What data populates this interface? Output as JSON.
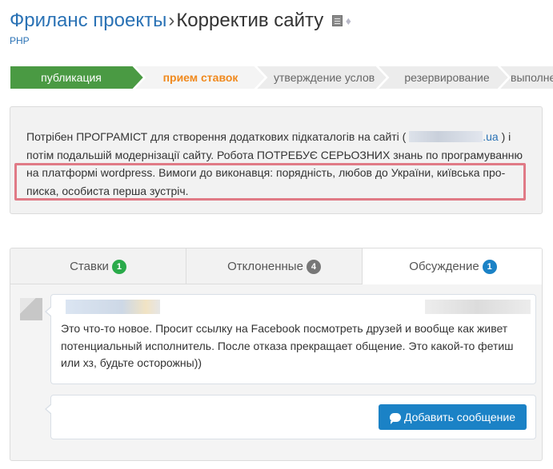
{
  "header": {
    "breadcrumb_link": "Фриланс проекты",
    "separator": "›",
    "project_title": "Корректив сайту",
    "category": "PHP",
    "icons": [
      "document-icon",
      "diamond-icon"
    ]
  },
  "stages": [
    {
      "label": "публикация",
      "state": "done",
      "bg": "#4a9a43",
      "color": "#ffffff"
    },
    {
      "label": "прием ставок",
      "state": "current",
      "bg": "#f4f4f4",
      "color": "#f0891d"
    },
    {
      "label": "утверждение условий",
      "state": "pending",
      "bg": "#ececec",
      "color": "#666666"
    },
    {
      "label": "резервирование",
      "state": "pending",
      "bg": "#ececec",
      "color": "#666666"
    },
    {
      "label": "выполнение",
      "state": "pending",
      "bg": "#ececec",
      "color": "#666666"
    }
  ],
  "description": {
    "part1": "Потрібен ПРОГРАМІСТ для створення додаткових підкаталогів на сайті (",
    "url_suffix": ".ua",
    "part2": ") і потім подальшій модернізації сайту. Робота ПОТРЕБУЄ СЕРЬОЗНИХ знань по програмуванню на платформі wordpress. Вимоги до виконавця: порядність, любов до України, київська про-писка, особиста перша зустріч."
  },
  "tabs": [
    {
      "label": "Ставки",
      "count": "1",
      "badge_color": "#2aaa4a",
      "active": false
    },
    {
      "label": "Отклоненные",
      "count": "4",
      "badge_color": "#777777",
      "active": false
    },
    {
      "label": "Обсуждение",
      "count": "1",
      "badge_color": "#1b82c6",
      "active": true
    }
  ],
  "discussion": {
    "comment_text": "Это что-то новое. Просит ссылку на Facebook посмотреть друзей и вообще как живет потенциальный исполнитель. После отказа прекращает общение. Это какой-то фетиш или хз, будьте осторожны))",
    "add_button_label": "Добавить сообщение"
  },
  "colors": {
    "link": "#2a72b5",
    "highlight_border": "#e07a86",
    "button": "#1b82c6"
  }
}
